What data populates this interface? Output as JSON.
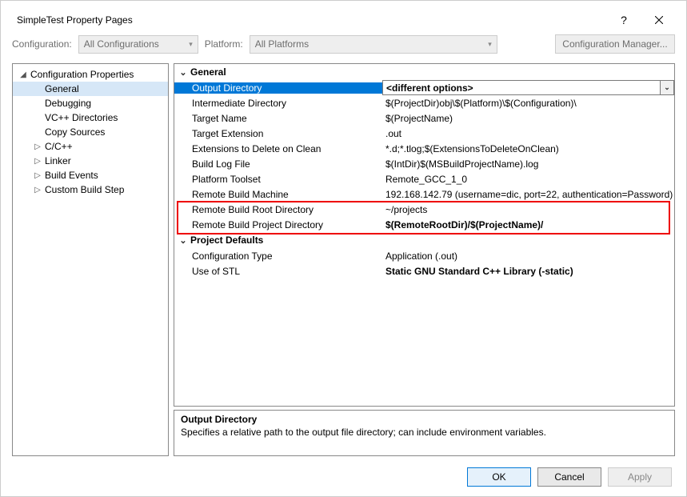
{
  "title": "SimpleTest Property Pages",
  "toolbar": {
    "configuration_label": "Configuration:",
    "configuration_value": "All Configurations",
    "platform_label": "Platform:",
    "platform_value": "All Platforms",
    "config_manager": "Configuration Manager..."
  },
  "tree": {
    "root": "Configuration Properties",
    "items": [
      {
        "label": "General",
        "selected": true
      },
      {
        "label": "Debugging"
      },
      {
        "label": "VC++ Directories"
      },
      {
        "label": "Copy Sources"
      },
      {
        "label": "C/C++",
        "expander": true
      },
      {
        "label": "Linker",
        "expander": true
      },
      {
        "label": "Build Events",
        "expander": true
      },
      {
        "label": "Custom Build Step",
        "expander": true
      }
    ]
  },
  "sections": [
    {
      "header": "General",
      "rows": [
        {
          "name": "Output Directory",
          "value": "<different options>",
          "selected": true,
          "bold_value": true,
          "dropdown": true
        },
        {
          "name": "Intermediate Directory",
          "value": "$(ProjectDir)obj\\$(Platform)\\$(Configuration)\\"
        },
        {
          "name": "Target Name",
          "value": "$(ProjectName)"
        },
        {
          "name": "Target Extension",
          "value": ".out"
        },
        {
          "name": "Extensions to Delete on Clean",
          "value": "*.d;*.tlog;$(ExtensionsToDeleteOnClean)"
        },
        {
          "name": "Build Log File",
          "value": "$(IntDir)$(MSBuildProjectName).log"
        },
        {
          "name": "Platform Toolset",
          "value": "Remote_GCC_1_0"
        },
        {
          "name": "Remote Build Machine",
          "value": "192.168.142.79 (username=dic, port=22, authentication=Password)"
        },
        {
          "name": "Remote Build Root Directory",
          "value": "~/projects",
          "highlighted": true
        },
        {
          "name": "Remote Build Project Directory",
          "value": "$(RemoteRootDir)/$(ProjectName)/",
          "bold_value": true,
          "highlighted": true
        }
      ]
    },
    {
      "header": "Project Defaults",
      "rows": [
        {
          "name": "Configuration Type",
          "value": "Application (.out)"
        },
        {
          "name": "Use of STL",
          "value": "Static GNU Standard C++ Library (-static)",
          "bold_value": true
        }
      ]
    }
  ],
  "description": {
    "title": "Output Directory",
    "text": "Specifies a relative path to the output file directory; can include environment variables."
  },
  "buttons": {
    "ok": "OK",
    "cancel": "Cancel",
    "apply": "Apply"
  }
}
